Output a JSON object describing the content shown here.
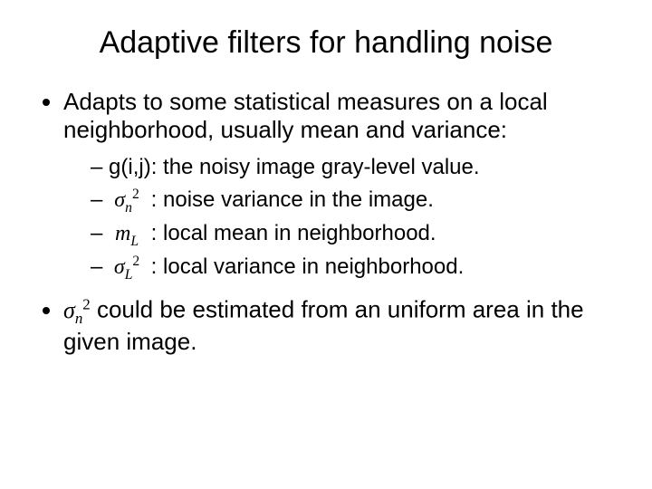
{
  "title": "Adaptive filters for handling noise",
  "bullets": {
    "b1": "Adapts to some statistical measures on a local neighborhood, usually mean and variance:",
    "sub": {
      "s1_pre": "g(i,j)",
      "s1_post": ": the noisy image gray-level value.",
      "s2_post": " : noise variance in the image.",
      "s3_post": " : local mean in neighborhood.",
      "s4_post": " : local variance in neighborhood."
    },
    "b2_post": "could be estimated from an uniform area in the given image."
  },
  "symbols": {
    "sigma": "σ",
    "m": "m",
    "sub_n": "n",
    "sub_L": "L",
    "sup_2": "2"
  }
}
